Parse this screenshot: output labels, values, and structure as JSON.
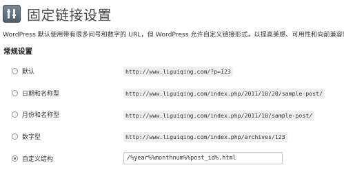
{
  "header": {
    "title": "固定链接设置",
    "icon": "settings-tools-icon"
  },
  "description": "WordPress 默认使用带有很多问号和数字的 URL，但 WordPress 允许自定义链接形式，以提高美感、可用性和向前兼容性",
  "common_settings": {
    "heading": "常规设置",
    "options": [
      {
        "label": "默认",
        "example": "http://www.liguiqing.com/?p=123",
        "checked": false
      },
      {
        "label": "日期和名称型",
        "example": "http://www.liguiqing.com/index.php/2011/10/20/sample-post/",
        "checked": false
      },
      {
        "label": "月份和名称型",
        "example": "http://www.liguiqing.com/index.php/2011/10/sample-post/",
        "checked": false
      },
      {
        "label": "数字型",
        "example": "http://www.liguiqing.com/index.php/archives/123",
        "checked": false
      },
      {
        "label": "自定义结构",
        "checked": true
      }
    ],
    "custom_structure_value": "/%year%%monthnum%%post_id%.html"
  },
  "colors": {
    "radio_dot": "#4a7a2a",
    "code_background": "#efefef"
  }
}
